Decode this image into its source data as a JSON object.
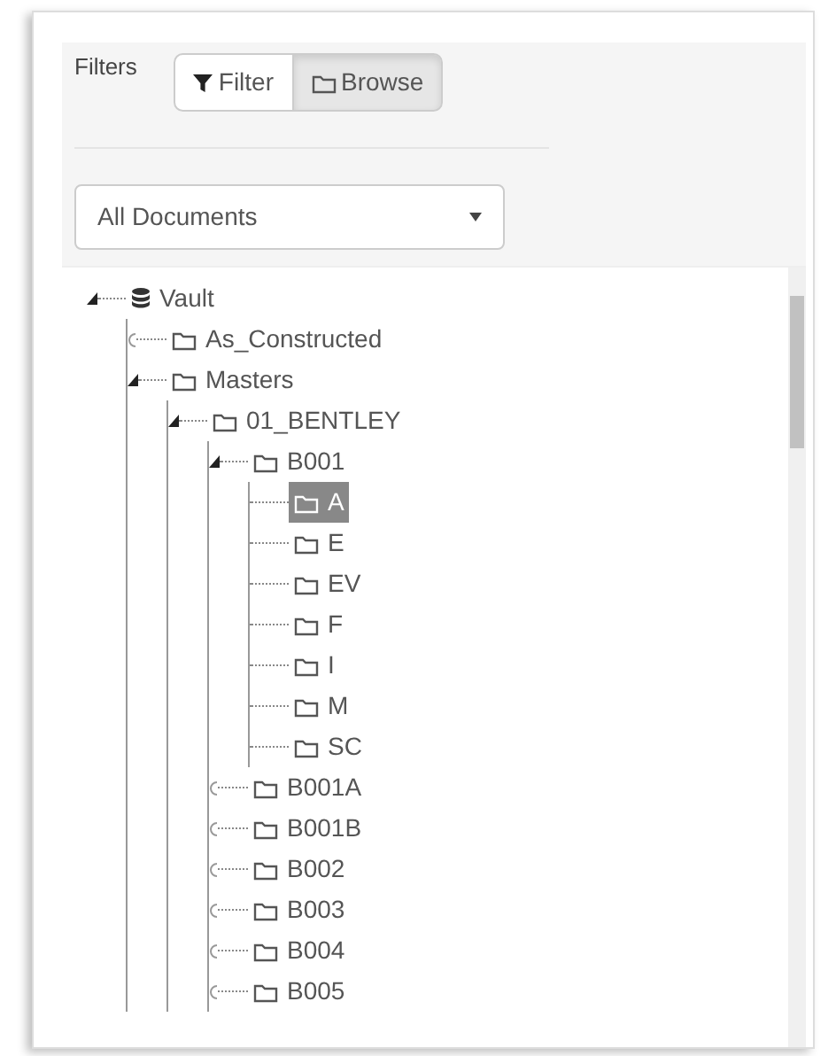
{
  "filters_label": "Filters",
  "view_toggle": [
    {
      "label": "Filter",
      "kind": "funnel",
      "selected": false
    },
    {
      "label": "Browse",
      "kind": "folder",
      "selected": true
    }
  ],
  "document_select": {
    "value": "All Documents"
  },
  "tree": [
    {
      "label": "Vault",
      "kind": "database",
      "expandable": true,
      "expanded": true,
      "selected": false,
      "children": [
        {
          "label": "As_Constructed",
          "kind": "folder",
          "expandable": true,
          "expanded": false,
          "selected": false
        },
        {
          "label": "Masters",
          "kind": "folder",
          "expandable": true,
          "expanded": true,
          "selected": false,
          "children": [
            {
              "label": "01_BENTLEY",
              "kind": "folder",
              "expandable": true,
              "expanded": true,
              "selected": false,
              "children": [
                {
                  "label": "B001",
                  "kind": "folder",
                  "expandable": true,
                  "expanded": true,
                  "selected": false,
                  "children": [
                    {
                      "label": "A",
                      "kind": "folder",
                      "expandable": false,
                      "selected": true
                    },
                    {
                      "label": "E",
                      "kind": "folder",
                      "expandable": false,
                      "selected": false
                    },
                    {
                      "label": "EV",
                      "kind": "folder",
                      "expandable": false,
                      "selected": false
                    },
                    {
                      "label": "F",
                      "kind": "folder",
                      "expandable": false,
                      "selected": false
                    },
                    {
                      "label": "I",
                      "kind": "folder",
                      "expandable": false,
                      "selected": false
                    },
                    {
                      "label": "M",
                      "kind": "folder",
                      "expandable": false,
                      "selected": false
                    },
                    {
                      "label": "SC",
                      "kind": "folder",
                      "expandable": false,
                      "selected": false
                    }
                  ]
                },
                {
                  "label": "B001A",
                  "kind": "folder",
                  "expandable": true,
                  "expanded": false,
                  "selected": false
                },
                {
                  "label": "B001B",
                  "kind": "folder",
                  "expandable": true,
                  "expanded": false,
                  "selected": false
                },
                {
                  "label": "B002",
                  "kind": "folder",
                  "expandable": true,
                  "expanded": false,
                  "selected": false
                },
                {
                  "label": "B003",
                  "kind": "folder",
                  "expandable": true,
                  "expanded": false,
                  "selected": false
                },
                {
                  "label": "B004",
                  "kind": "folder",
                  "expandable": true,
                  "expanded": false,
                  "selected": false
                },
                {
                  "label": "B005",
                  "kind": "folder",
                  "expandable": true,
                  "expanded": false,
                  "selected": false
                }
              ]
            }
          ]
        }
      ]
    }
  ]
}
